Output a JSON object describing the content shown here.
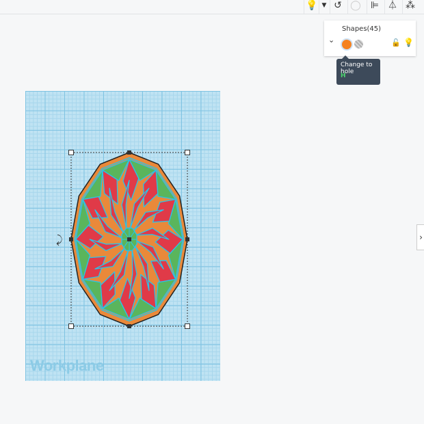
{
  "toolbar": {
    "icons": [
      "lightbulb-icon",
      "dropdown-icon",
      "note-icon",
      "group-icon",
      "align-icon",
      "mirror-icon",
      "cruise-icon"
    ]
  },
  "shapes_panel": {
    "title": "Shapes(45)",
    "solid_color": "#f58220",
    "lock_icon": "unlock-icon",
    "visibility_icon": "lightbulb-icon"
  },
  "tooltip": {
    "text": "Change to hole",
    "shortcut": "H"
  },
  "workplane": {
    "label": "Workplane"
  },
  "colors": {
    "orange": "#e9893a",
    "red": "#e03a48",
    "green": "#5ab55c",
    "outline": "#29c4ea"
  }
}
